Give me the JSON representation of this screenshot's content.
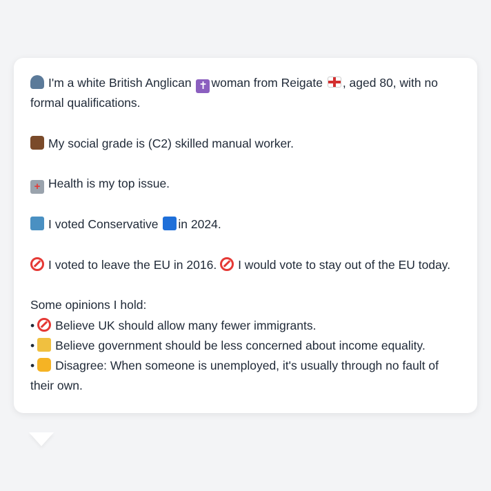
{
  "profile": {
    "line1_pre": "I'm a white British Anglican",
    "line1_mid": "woman from Reigate",
    "line1_post": ", aged 80, with no formal qualifications.",
    "line2": "My social grade is (C2) skilled manual worker.",
    "line3": "Health is my top issue.",
    "line4_pre": "I voted Conservative",
    "line4_post": "in 2024.",
    "line5_pre": "I voted to leave the EU in 2016.",
    "line5_post": "I would vote to stay out of the EU today.",
    "opinions_heading": "Some opinions I hold:",
    "opinions": [
      {
        "bullet": "•",
        "icon": "no-entry-icon",
        "text": "Believe UK should allow many fewer immigrants."
      },
      {
        "bullet": "•",
        "icon": "scales-icon",
        "text": "Believe government should be less concerned about income equality."
      },
      {
        "bullet": "•",
        "icon": "thumbs-down-icon",
        "text": "Disagree: When someone is unemployed, it's usually through no fault of their own."
      }
    ]
  },
  "colors": {
    "background": "#f3f4f6",
    "card": "#ffffff",
    "text": "#1f2937"
  }
}
